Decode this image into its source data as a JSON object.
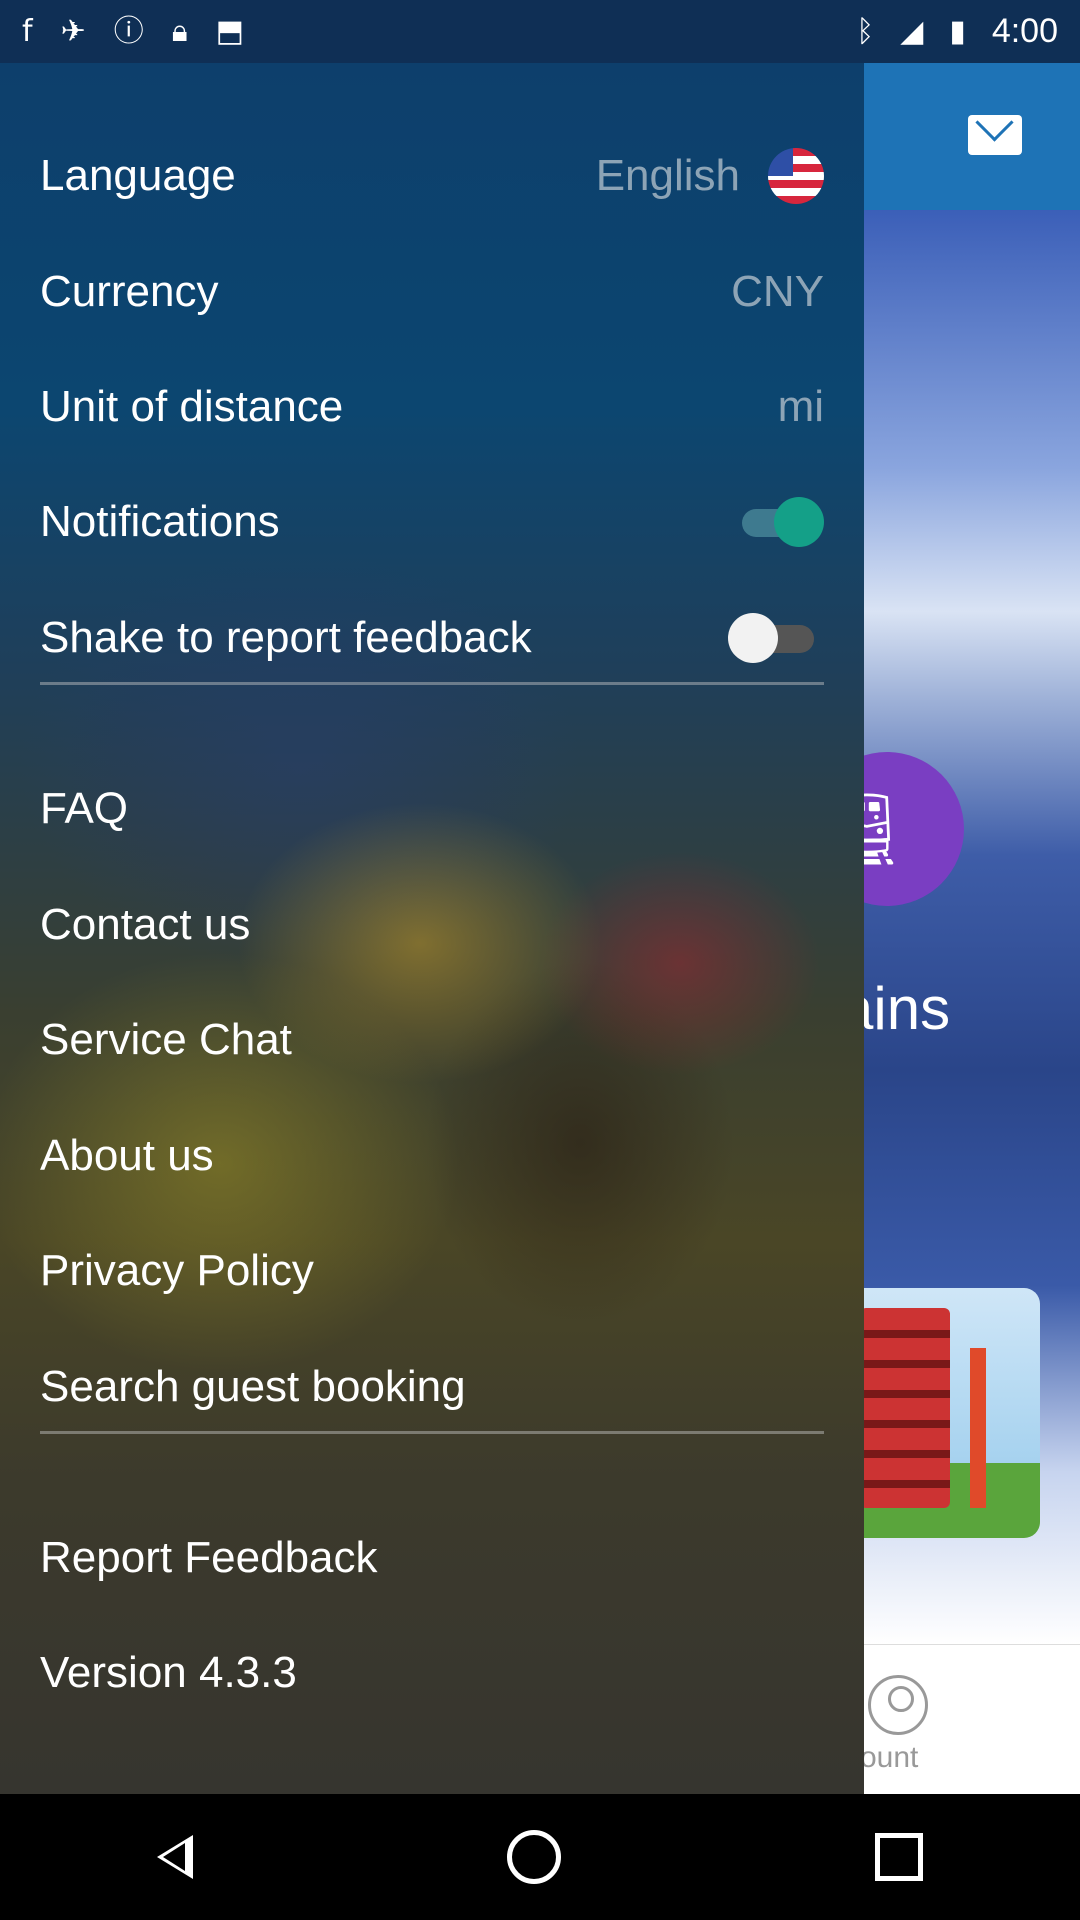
{
  "status_bar": {
    "time": "4:00",
    "left_icons": [
      "facebook-icon",
      "satellite-icon",
      "alert-icon",
      "lock-icon",
      "android-icon"
    ],
    "right_icons": [
      "bluetooth-icon",
      "signal-icon",
      "battery-icon"
    ]
  },
  "background_app": {
    "hero_text": "ains",
    "account_label": "ccount"
  },
  "drawer": {
    "settings": [
      {
        "label": "Language",
        "value": "English"
      },
      {
        "label": "Currency",
        "value": "CNY"
      },
      {
        "label": "Unit of distance",
        "value": "mi"
      },
      {
        "label": "Notifications",
        "toggle": true
      },
      {
        "label": "Shake to report feedback",
        "toggle": false
      }
    ],
    "menu": [
      {
        "label": "FAQ"
      },
      {
        "label": "Contact us"
      },
      {
        "label": "Service Chat"
      },
      {
        "label": "About us"
      },
      {
        "label": "Privacy Policy"
      },
      {
        "label": "Search guest booking"
      }
    ],
    "footer": [
      {
        "label": "Report Feedback"
      },
      {
        "label": "Version 4.3.3"
      }
    ]
  },
  "colors": {
    "header_blue": "#1e73b6",
    "toggle_on": "#14a088",
    "value_text": "#8da4b6"
  }
}
